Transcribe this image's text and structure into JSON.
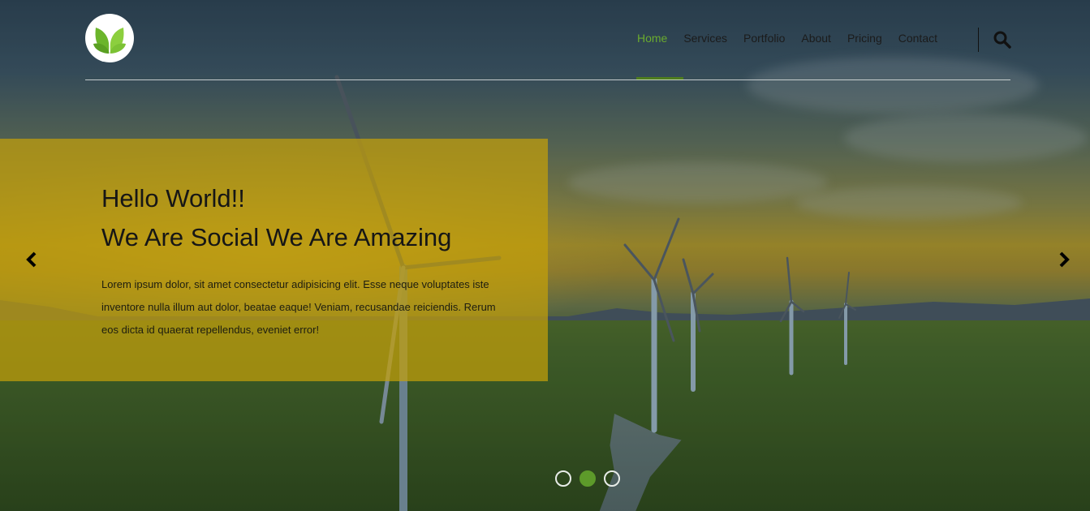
{
  "brand": {
    "logo_icon": "leaf-icon",
    "accent_color": "#6aab2e"
  },
  "nav": {
    "items": [
      {
        "label": "Home",
        "active": true
      },
      {
        "label": "Services",
        "active": false
      },
      {
        "label": "Portfolio",
        "active": false
      },
      {
        "label": "About",
        "active": false
      },
      {
        "label": "Pricing",
        "active": false
      },
      {
        "label": "Contact",
        "active": false
      }
    ],
    "search_icon": "search-icon"
  },
  "hero": {
    "title_line1": "Hello World!!",
    "title_line2": "We Are Social We Are Amazing",
    "body": "Lorem ipsum dolor, sit amet consectetur adipisicing elit. Esse neque voluptates iste inventore nulla illum aut dolor, beatae eaque! Veniam, recusandae reiciendis. Rerum eos dicta id quaerat repellendus, eveniet error!",
    "caption_color": "#c4a00a"
  },
  "carousel": {
    "prev_icon": "chevron-left-icon",
    "next_icon": "chevron-right-icon",
    "slide_count": 3,
    "active_slide": 2
  }
}
